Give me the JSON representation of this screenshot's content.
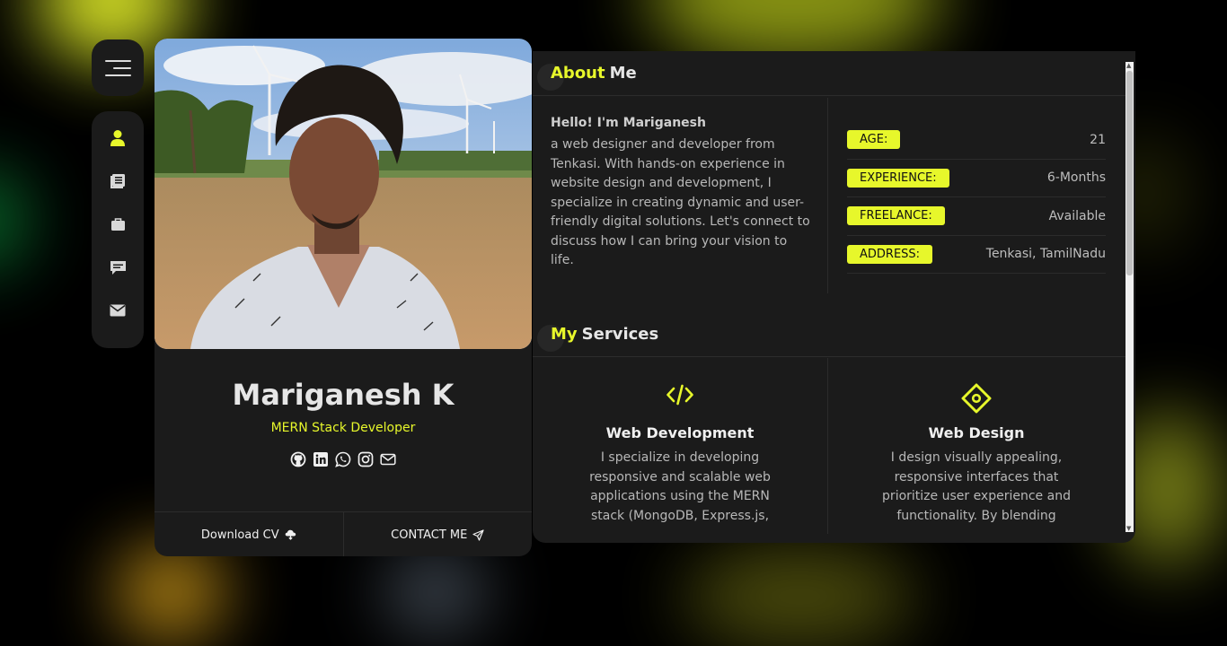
{
  "colors": {
    "accent": "#e7f72b",
    "panel": "#1b1b1b",
    "background": "#000000"
  },
  "menu": {
    "icon": "hamburger-icon"
  },
  "nav": {
    "items": [
      {
        "icon": "user-icon",
        "active": true
      },
      {
        "icon": "resume-icon",
        "active": false
      },
      {
        "icon": "briefcase-icon",
        "active": false
      },
      {
        "icon": "chat-icon",
        "active": false
      },
      {
        "icon": "envelope-icon",
        "active": false
      }
    ]
  },
  "profile": {
    "name": "Mariganesh K",
    "role": "MERN Stack Developer",
    "socials": [
      "github-icon",
      "linkedin-icon",
      "whatsapp-icon",
      "instagram-icon",
      "mail-icon"
    ],
    "download_label": "Download CV",
    "contact_label": "CONTACT ME"
  },
  "about": {
    "title_highlight": "About",
    "title_rest": "Me",
    "greeting": "Hello! I'm Mariganesh",
    "description": "a web designer and developer from Tenkasi. With hands-on experience in website design and development, I specialize in creating dynamic and user-friendly digital solutions. Let's connect to discuss how I can bring your vision to life.",
    "info": [
      {
        "label": "AGE:",
        "value": "21"
      },
      {
        "label": "EXPERIENCE:",
        "value": "6-Months"
      },
      {
        "label": "FREELANCE:",
        "value": "Available"
      },
      {
        "label": "ADDRESS:",
        "value": "Tenkasi, TamilNadu"
      }
    ]
  },
  "services": {
    "title_highlight": "My",
    "title_rest": "Services",
    "items": [
      {
        "icon": "code-icon",
        "title": "Web Development",
        "description": "I specialize in developing responsive and scalable web applications using the MERN stack (MongoDB, Express.js,"
      },
      {
        "icon": "design-icon",
        "title": "Web Design",
        "description": "I design visually appealing, responsive interfaces that prioritize user experience and functionality. By blending"
      }
    ]
  }
}
